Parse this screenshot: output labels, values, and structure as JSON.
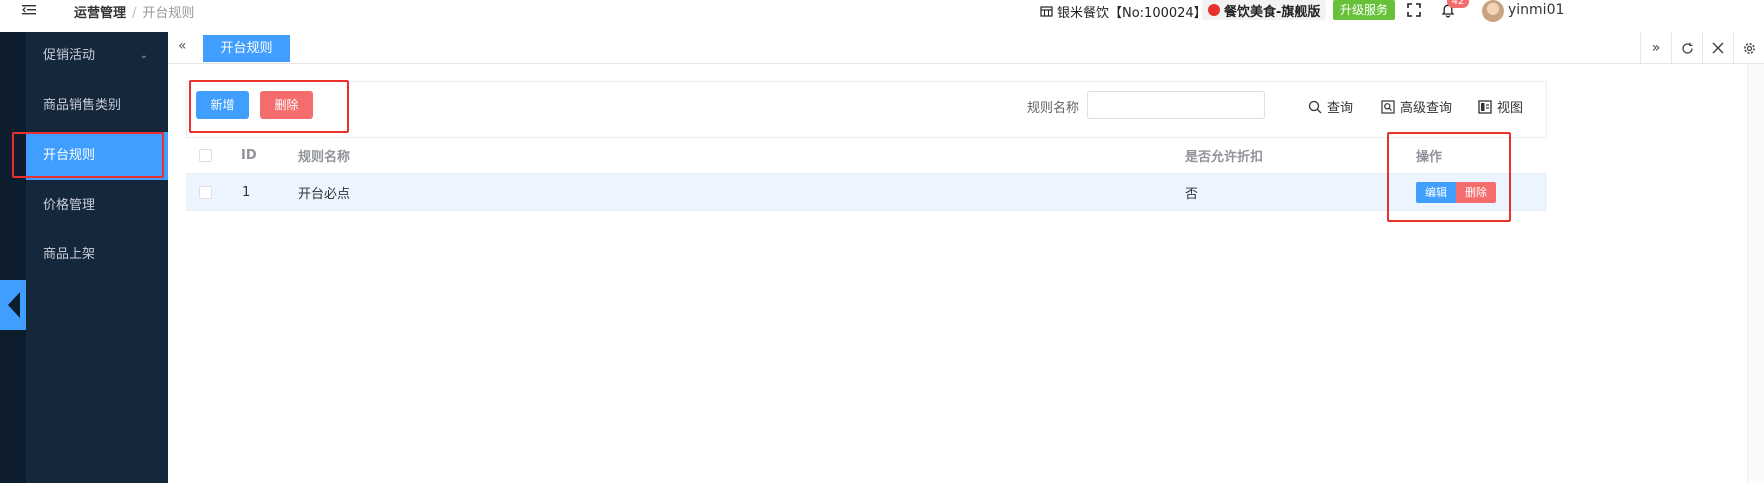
{
  "header": {
    "breadcrumb_root": "运营管理",
    "breadcrumb_sep": "/",
    "breadcrumb_current": "开台规则",
    "store_info": "银米餐饮【No:100024】",
    "brand": "餐饮美食-旗舰版",
    "upgrade_label": "升级服务",
    "notification_count": "42",
    "username": "yinmi01"
  },
  "sidebar": {
    "items": [
      {
        "label": "促销活动"
      },
      {
        "label": "商品销售类别"
      },
      {
        "label": "开台规则"
      },
      {
        "label": "价格管理"
      },
      {
        "label": "商品上架"
      }
    ]
  },
  "tabs": {
    "active_label": "开台规则"
  },
  "toolbar": {
    "add_label": "新增",
    "delete_label": "删除",
    "filter_label": "规则名称",
    "filter_value": "",
    "query_label": "查询",
    "advanced_query_label": "高级查询",
    "view_label": "视图"
  },
  "table": {
    "columns": [
      "ID",
      "规则名称",
      "是否允许折扣",
      "操作"
    ],
    "rows": [
      {
        "id": "1",
        "name": "开台必点",
        "allow_discount": "否",
        "edit_label": "编辑",
        "delete_label": "删除"
      }
    ]
  },
  "colors": {
    "primary": "#409eff",
    "danger": "#f56c6c",
    "success": "#67c23a",
    "sidebar_bg": "#15273b",
    "annotation": "#e8312c"
  }
}
